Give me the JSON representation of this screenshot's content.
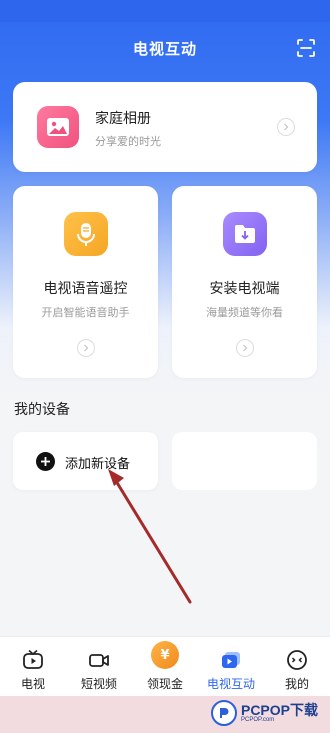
{
  "header": {
    "title": "电视互动",
    "scan_icon": "scan-icon"
  },
  "cards": {
    "album": {
      "title": "家庭相册",
      "subtitle": "分享爱的时光",
      "icon": "photo-icon",
      "color": "#f0527f"
    },
    "voice": {
      "title": "电视语音遥控",
      "subtitle": "开启智能语音助手",
      "icon": "microphone-icon",
      "color": "#f5a623"
    },
    "install": {
      "title": "安装电视端",
      "subtitle": "海量频道等你看",
      "icon": "folder-download-icon",
      "color": "#8362f0"
    }
  },
  "devices": {
    "section_title": "我的设备",
    "add_label": "添加新设备"
  },
  "nav": {
    "items": [
      {
        "label": "电视",
        "icon": "tv-icon",
        "active": false
      },
      {
        "label": "短视频",
        "icon": "video-camera-icon",
        "active": false
      },
      {
        "label": "领现金",
        "icon": "yuan-coin-icon",
        "active": false,
        "glyph": "¥"
      },
      {
        "label": "电视互动",
        "icon": "tv-interact-icon",
        "active": true
      },
      {
        "label": "我的",
        "icon": "profile-face-icon",
        "active": false
      }
    ]
  },
  "watermark": {
    "brand": "PCPOP下载",
    "sub": "PCPOP.com"
  },
  "colors": {
    "accent": "#2f66ee",
    "nav_active": "#2f66ee",
    "annotation_arrow": "#a52a2a"
  }
}
